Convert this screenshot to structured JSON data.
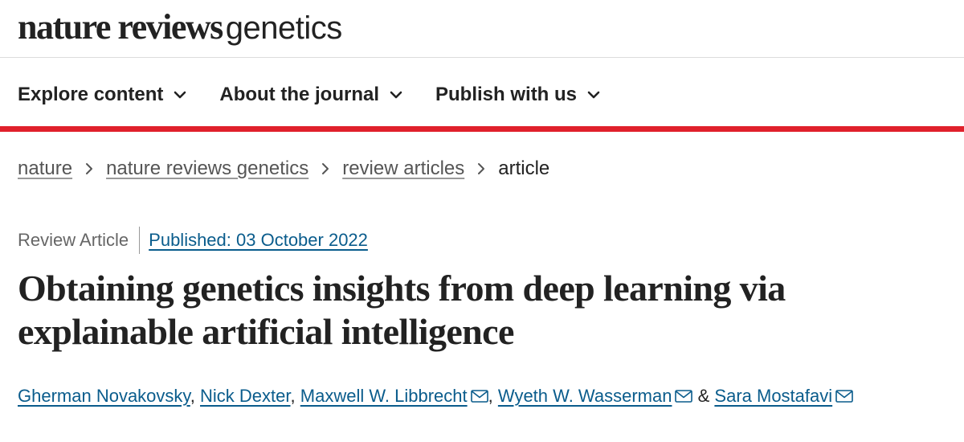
{
  "header": {
    "logo_bold": "nature reviews",
    "logo_light": "genetics"
  },
  "nav": {
    "items": [
      {
        "label": "Explore content",
        "icon": "chevron-down-icon"
      },
      {
        "label": "About the journal",
        "icon": "chevron-down-icon"
      },
      {
        "label": "Publish with us",
        "icon": "chevron-down-icon"
      }
    ]
  },
  "breadcrumb": {
    "items": [
      "nature",
      "nature reviews genetics",
      "review articles"
    ],
    "current": "article"
  },
  "article": {
    "type": "Review Article",
    "published": "Published: 03 October 2022",
    "title": "Obtaining genetics insights from deep learning via explainable artificial intelligence",
    "authors": [
      {
        "name": "Gherman Novakovsky",
        "mail": false
      },
      {
        "name": "Nick Dexter",
        "mail": false
      },
      {
        "name": "Maxwell W. Libbrecht",
        "mail": true
      },
      {
        "name": "Wyeth W. Wasserman",
        "mail": true
      },
      {
        "name": "Sara Mostafavi",
        "mail": true
      }
    ],
    "separator_comma": ",",
    "separator_and": "&"
  },
  "colors": {
    "accent_red": "#e0202b",
    "link_blue": "#0a5c8c",
    "text": "#222222"
  }
}
